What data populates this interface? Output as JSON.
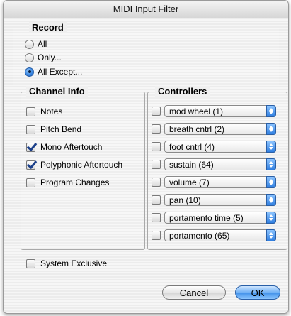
{
  "window": {
    "title": "MIDI Input Filter"
  },
  "record": {
    "legend": "Record",
    "options": [
      {
        "label": "All",
        "selected": false
      },
      {
        "label": "Only...",
        "selected": false
      },
      {
        "label": "All Except...",
        "selected": true
      }
    ]
  },
  "channel_info": {
    "legend": "Channel Info",
    "items": [
      {
        "label": "Notes",
        "checked": false
      },
      {
        "label": "Pitch Bend",
        "checked": false
      },
      {
        "label": "Mono Aftertouch",
        "checked": true
      },
      {
        "label": "Polyphonic Aftertouch",
        "checked": true
      },
      {
        "label": "Program Changes",
        "checked": false
      }
    ]
  },
  "controllers": {
    "legend": "Controllers",
    "items": [
      {
        "value": "mod wheel (1)",
        "checked": false
      },
      {
        "value": "breath cntrl (2)",
        "checked": false
      },
      {
        "value": "foot cntrl (4)",
        "checked": false
      },
      {
        "value": "sustain (64)",
        "checked": false
      },
      {
        "value": "volume (7)",
        "checked": false
      },
      {
        "value": "pan (10)",
        "checked": false
      },
      {
        "value": "portamento time (5)",
        "checked": false
      },
      {
        "value": "portamento (65)",
        "checked": false
      }
    ]
  },
  "system_exclusive": {
    "label": "System Exclusive",
    "checked": false
  },
  "buttons": {
    "cancel": "Cancel",
    "ok": "OK"
  }
}
